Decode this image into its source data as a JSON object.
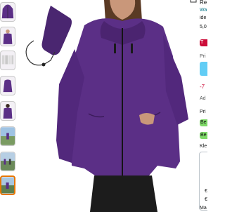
{
  "colors": {
    "jacket": "#5b2f86",
    "jacket_dark": "#47216b",
    "accent_red": "#cc0c39",
    "accent_blue": "#62cdf5",
    "badge_green": "#7fda69",
    "selected_thumb": "#e77600"
  },
  "thumbnails": [
    {
      "name": "thumb-jacket-front",
      "icon": "purple-jacket"
    },
    {
      "name": "thumb-jacket-worn",
      "icon": "purple-jacket-model"
    },
    {
      "name": "thumb-colors",
      "icon": "color-variants"
    },
    {
      "name": "thumb-jacket-detail",
      "icon": "purple-jacket"
    },
    {
      "name": "thumb-jacket-back",
      "icon": "purple-jacket"
    },
    {
      "name": "thumb-outdoor-1",
      "icon": "outdoor-scene"
    },
    {
      "name": "thumb-outdoor-2",
      "icon": "outdoor-scene"
    },
    {
      "name": "thumb-outdoor-3",
      "icon": "outdoor-scene"
    }
  ],
  "right_panel": {
    "title_fragment": "Re",
    "brand_fragment": "Wa",
    "desc_fragment": "ide",
    "rating_fragment": "5,0",
    "deal_badge": "T",
    "price_label": "Pri",
    "discount": "-7",
    "shipping_fragment": "Ad",
    "price_row": "Pri",
    "badge1": "Be",
    "badge2": "Be",
    "size_label": "Kle",
    "card_price": "€",
    "card_price2": "€",
    "bottom_fragment": "Ma"
  }
}
